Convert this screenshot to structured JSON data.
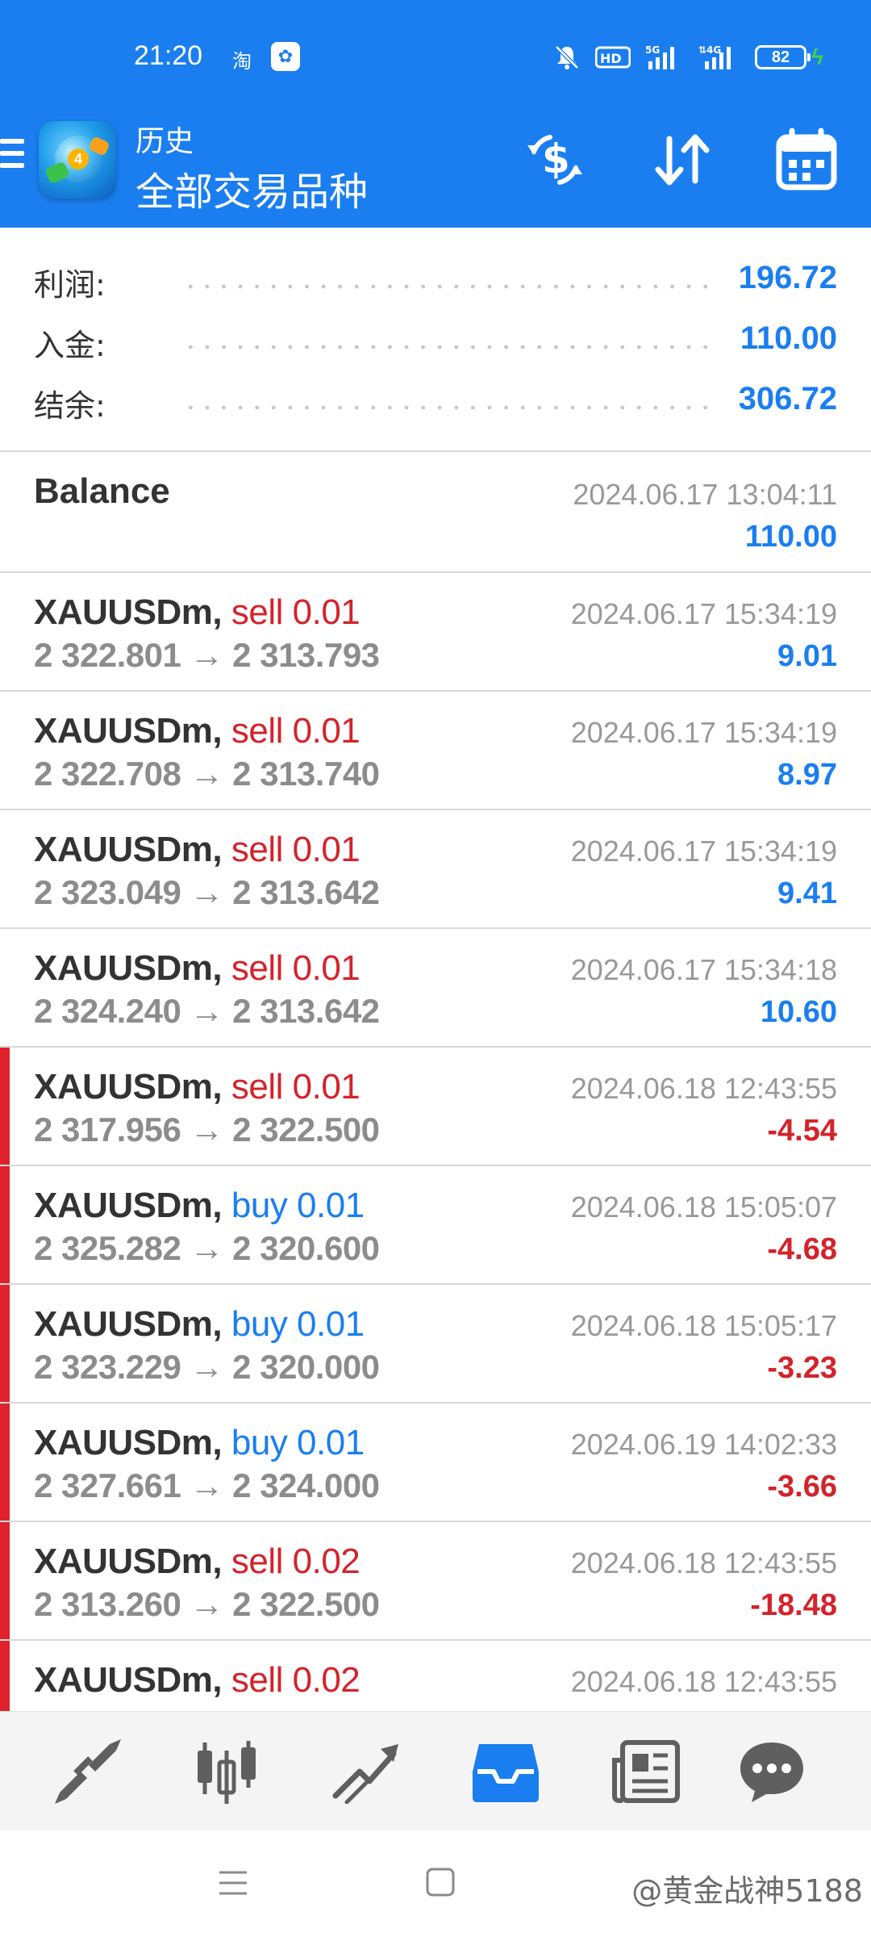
{
  "status_bar": {
    "time": "21:20",
    "app_icon_1": "淘",
    "app_icon_2": "✿",
    "battery": "82"
  },
  "header": {
    "title_small": "历史",
    "title_big": "全部交易品种",
    "icons": [
      "menu-icon",
      "currency-exchange-icon",
      "sort-icon",
      "calendar-icon"
    ]
  },
  "summary": {
    "profit_label": "利润:",
    "profit_value": "196.72",
    "deposit_label": "入金:",
    "deposit_value": "110.00",
    "balance_label": "结余:",
    "balance_value": "306.72"
  },
  "balance_row": {
    "title": "Balance",
    "time": "2024.06.17 13:04:11",
    "amount": "110.00"
  },
  "trades": [
    {
      "symbol": "XAUUSDm,",
      "side": "sell 0.01",
      "prices": "2 322.801 → 2 313.793",
      "time": "2024.06.17 15:34:19",
      "profit": "9.01"
    },
    {
      "symbol": "XAUUSDm,",
      "side": "sell 0.01",
      "prices": "2 322.708 → 2 313.740",
      "time": "2024.06.17 15:34:19",
      "profit": "8.97"
    },
    {
      "symbol": "XAUUSDm,",
      "side": "sell 0.01",
      "prices": "2 323.049 → 2 313.642",
      "time": "2024.06.17 15:34:19",
      "profit": "9.41"
    },
    {
      "symbol": "XAUUSDm,",
      "side": "sell 0.01",
      "prices": "2 324.240 → 2 313.642",
      "time": "2024.06.17 15:34:18",
      "profit": "10.60"
    },
    {
      "symbol": "XAUUSDm,",
      "side": "sell 0.01",
      "prices": "2 317.956 → 2 322.500",
      "time": "2024.06.18 12:43:55",
      "profit": "-4.54"
    },
    {
      "symbol": "XAUUSDm,",
      "side": "buy 0.01",
      "prices": "2 325.282 → 2 320.600",
      "time": "2024.06.18 15:05:07",
      "profit": "-4.68"
    },
    {
      "symbol": "XAUUSDm,",
      "side": "buy 0.01",
      "prices": "2 323.229 → 2 320.000",
      "time": "2024.06.18 15:05:17",
      "profit": "-3.23"
    },
    {
      "symbol": "XAUUSDm,",
      "side": "buy 0.01",
      "prices": "2 327.661 → 2 324.000",
      "time": "2024.06.19 14:02:33",
      "profit": "-3.66"
    },
    {
      "symbol": "XAUUSDm,",
      "side": "sell 0.02",
      "prices": "2 313.260 → 2 322.500",
      "time": "2024.06.18 12:43:55",
      "profit": "-18.48"
    },
    {
      "symbol": "XAUUSDm,",
      "side": "sell 0.02",
      "prices": "",
      "time": "2024.06.18 12:43:55",
      "profit": ""
    }
  ],
  "bottom_nav": {
    "items": [
      "quotes-icon",
      "chart-icon",
      "trade-icon",
      "history-icon",
      "news-icon",
      "chat-icon"
    ],
    "active": "history-icon",
    "active_color": "#1a7ef0",
    "inactive_color": "#5f5f5f"
  },
  "system_bar": {
    "watermark": "@黄金战神5188"
  },
  "colors": {
    "header_bg": "#1a7ef0",
    "profit_positive": "#1a7ef0",
    "profit_negative": "#d3232b",
    "sell": "#d3232b",
    "buy": "#1a7ef0",
    "loss_marker": "#e0222c"
  }
}
